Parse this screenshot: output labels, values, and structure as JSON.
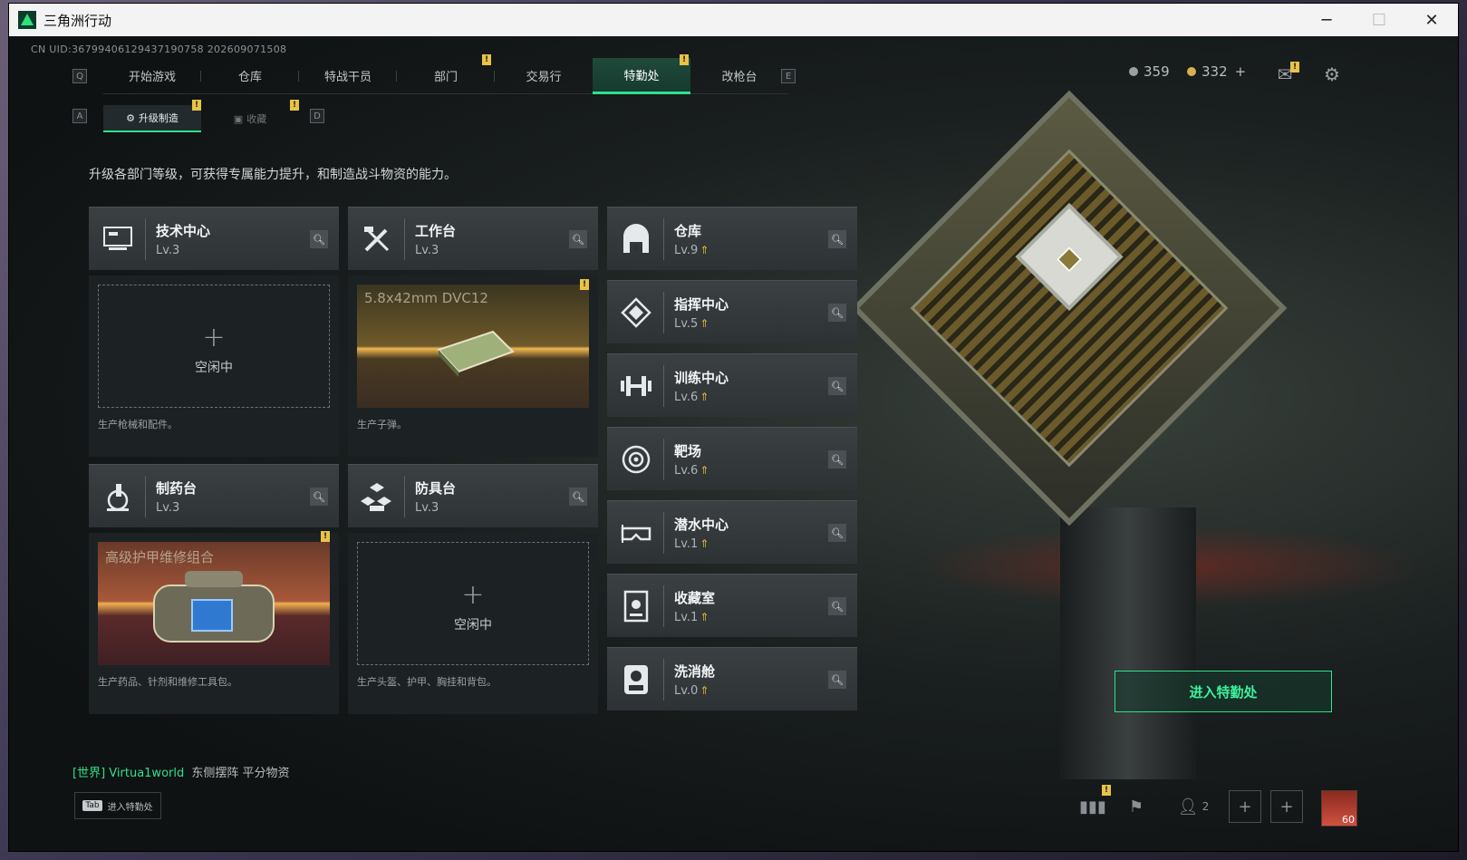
{
  "window": {
    "title": "三角洲行动",
    "controls": {
      "minimize": "─",
      "maximize": "☐",
      "close": "✕"
    }
  },
  "uid": "CN UID:36799406129437190758 202609071508",
  "topnav": {
    "left_key": "Q",
    "right_key": "E",
    "tabs": [
      {
        "label": "开始游戏"
      },
      {
        "label": "仓库"
      },
      {
        "label": "特战干员"
      },
      {
        "label": "部门",
        "badge": "!"
      },
      {
        "label": "交易行"
      },
      {
        "label": "特勤处",
        "badge": "!"
      },
      {
        "label": "改枪台"
      }
    ],
    "active": "特勤处"
  },
  "subnav": {
    "left_key": "A",
    "right_key": "D",
    "tabs": [
      {
        "label": "升级制造",
        "badge": "!"
      },
      {
        "label": "收藏",
        "badge": "!"
      }
    ],
    "active": "升级制造"
  },
  "currency": {
    "gray": "359",
    "gold": "332",
    "plus": "+"
  },
  "mail_badge": "!",
  "intro": "升级各部门等级，可获得专属能力提升，和制造战斗物资的能力。",
  "workstations": [
    {
      "name": "技术中心",
      "level": "Lv.3",
      "icon": "computer-icon",
      "slot": {
        "type": "empty",
        "plus": "+",
        "state": "空闲中"
      },
      "desc": "生产枪械和配件。"
    },
    {
      "name": "工作台",
      "level": "Lv.3",
      "icon": "tools-icon",
      "slot": {
        "type": "item",
        "item": "5.8x42mm DVC12",
        "badge": "!"
      },
      "desc": "生产子弹。"
    },
    {
      "name": "制药台",
      "level": "Lv.3",
      "icon": "microscope-icon",
      "slot": {
        "type": "item",
        "item": "高级护甲维修组合",
        "badge": "!"
      },
      "desc": "生产药品、针剂和维修工具包。"
    },
    {
      "name": "防具台",
      "level": "Lv.3",
      "icon": "armor-blocks-icon",
      "slot": {
        "type": "empty",
        "plus": "+",
        "state": "空闲中"
      },
      "desc": "生产头盔、护甲、胸挂和背包。"
    }
  ],
  "facilities": [
    {
      "name": "仓库",
      "level": "Lv.9",
      "icon": "warehouse-icon"
    },
    {
      "name": "指挥中心",
      "level": "Lv.5",
      "icon": "command-icon"
    },
    {
      "name": "训练中心",
      "level": "Lv.6",
      "icon": "dumbbell-icon"
    },
    {
      "name": "靶场",
      "level": "Lv.6",
      "icon": "target-icon"
    },
    {
      "name": "潜水中心",
      "level": "Lv.1",
      "icon": "diving-mask-icon"
    },
    {
      "name": "收藏室",
      "level": "Lv.1",
      "icon": "collection-icon"
    },
    {
      "name": "洗消舱",
      "level": "Lv.0",
      "icon": "decon-icon"
    }
  ],
  "enter_button": "进入特勤处",
  "chat": {
    "channel": "[世界]",
    "name": "Virtua1world",
    "message": "东侧摆阵 平分物资"
  },
  "tab_hint": {
    "key": "Tab",
    "label": "进入特勤处"
  },
  "bottom": {
    "stats_badge": "!",
    "friends_count": "2",
    "avatar_level": "60"
  },
  "colors": {
    "accent": "#2fe08a",
    "badge": "#e8c34a",
    "upgrade_arrow": "#e0b63e"
  }
}
